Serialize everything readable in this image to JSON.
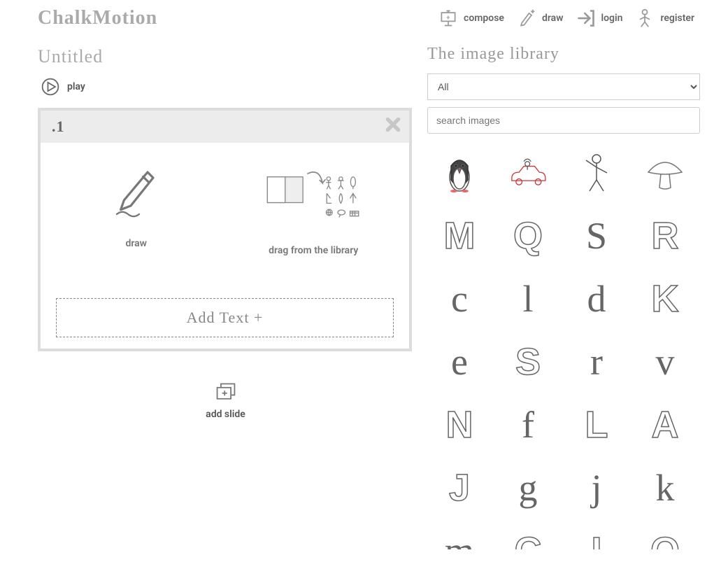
{
  "app": {
    "name": "ChalkMotion"
  },
  "nav": {
    "compose": "compose",
    "draw": "draw",
    "login": "login",
    "register": "register"
  },
  "doc": {
    "title": "Untitled"
  },
  "controls": {
    "play": "play",
    "add_slide": "add slide"
  },
  "slide": {
    "number": ".1",
    "draw_label": "draw",
    "drag_label": "drag from the library",
    "add_text": "Add Text +"
  },
  "library": {
    "title": "The image library",
    "filter_selected": "All",
    "search_placeholder": "search images",
    "items": [
      {
        "kind": "svg",
        "name": "penguin"
      },
      {
        "kind": "svg",
        "name": "car"
      },
      {
        "kind": "svg",
        "name": "stick-person"
      },
      {
        "kind": "svg",
        "name": "mushroom"
      },
      {
        "kind": "glyph",
        "style": "outline",
        "char": "M"
      },
      {
        "kind": "glyph",
        "style": "outline",
        "char": "Q"
      },
      {
        "kind": "glyph",
        "style": "script",
        "char": "S"
      },
      {
        "kind": "glyph",
        "style": "outline",
        "char": "R"
      },
      {
        "kind": "glyph",
        "style": "script",
        "char": "c"
      },
      {
        "kind": "glyph",
        "style": "script",
        "char": "l"
      },
      {
        "kind": "glyph",
        "style": "script",
        "char": "d"
      },
      {
        "kind": "glyph",
        "style": "outline",
        "char": "K"
      },
      {
        "kind": "glyph",
        "style": "script",
        "char": "e"
      },
      {
        "kind": "glyph",
        "style": "outline",
        "char": "S"
      },
      {
        "kind": "glyph",
        "style": "script",
        "char": "r"
      },
      {
        "kind": "glyph",
        "style": "script",
        "char": "v"
      },
      {
        "kind": "glyph",
        "style": "outline",
        "char": "N"
      },
      {
        "kind": "glyph",
        "style": "script",
        "char": "f"
      },
      {
        "kind": "glyph",
        "style": "outline",
        "char": "L"
      },
      {
        "kind": "glyph",
        "style": "outline",
        "char": "A"
      },
      {
        "kind": "glyph",
        "style": "outline",
        "char": "J"
      },
      {
        "kind": "glyph",
        "style": "script",
        "char": "g"
      },
      {
        "kind": "glyph",
        "style": "script",
        "char": "j"
      },
      {
        "kind": "glyph",
        "style": "script",
        "char": "k"
      },
      {
        "kind": "glyph",
        "style": "script",
        "char": "m"
      },
      {
        "kind": "glyph",
        "style": "outline",
        "char": "C"
      },
      {
        "kind": "glyph",
        "style": "outline",
        "char": "I"
      },
      {
        "kind": "glyph",
        "style": "outline",
        "char": "O"
      }
    ]
  }
}
